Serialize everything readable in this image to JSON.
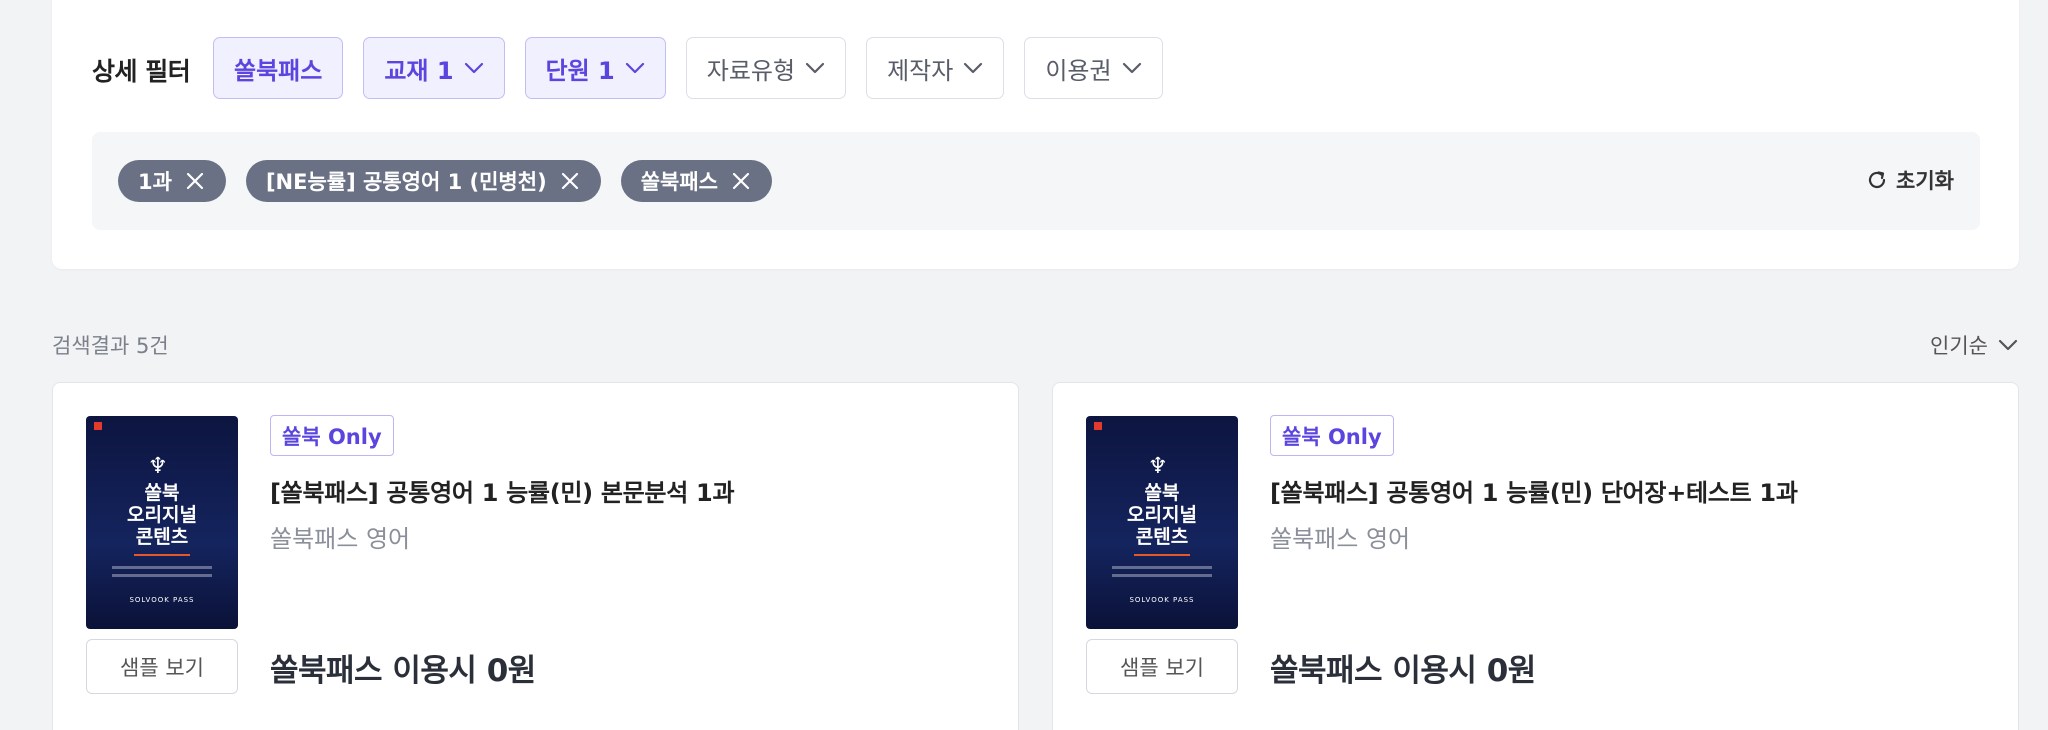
{
  "filter": {
    "title": "상세 필터",
    "chips": [
      {
        "label": "쏠북패스",
        "active": true,
        "dropdown": false
      },
      {
        "label": "교재 1",
        "active": true,
        "dropdown": true
      },
      {
        "label": "단원 1",
        "active": true,
        "dropdown": true
      },
      {
        "label": "자료유형",
        "active": false,
        "dropdown": true
      },
      {
        "label": "제작자",
        "active": false,
        "dropdown": true
      },
      {
        "label": "이용권",
        "active": false,
        "dropdown": true
      }
    ],
    "selected_tags": [
      "1과",
      "[NE능률] 공통영어 1 (민병천)",
      "쏠북패스"
    ],
    "reset_label": "초기화"
  },
  "results": {
    "count_label": "검색결과 5건",
    "sort_label": "인기순"
  },
  "products": [
    {
      "badge": "쏠북 Only",
      "title": "[쏠북패스] 공통영어 1 능률(민) 본문분석 1과",
      "subtitle": "쏠북패스 영어",
      "price": "쏠북패스 이용시 0원",
      "sample_label": "샘플 보기",
      "cover_text": "쏠북\n오리지널\n콘텐츠",
      "cover_brand": "SOLVOOK PASS"
    },
    {
      "badge": "쏠북 Only",
      "title": "[쏠북패스] 공통영어 1 능률(민) 단어장+테스트 1과",
      "subtitle": "쏠북패스 영어",
      "price": "쏠북패스 이용시 0원",
      "sample_label": "샘플 보기",
      "cover_text": "쏠북\n오리지널\n콘텐츠",
      "cover_brand": "SOLVOOK PASS"
    }
  ],
  "colors": {
    "accent": "#5b45df",
    "tag_bg": "#6b7185",
    "page_bg": "#f2f3f5"
  }
}
